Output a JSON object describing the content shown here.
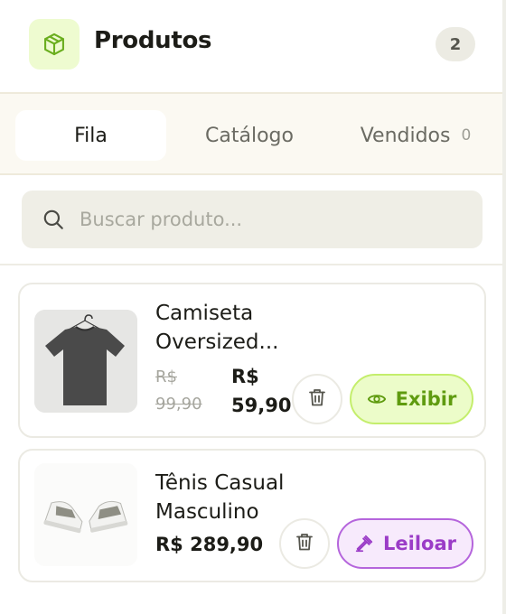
{
  "header": {
    "title": "Produtos",
    "count": "2",
    "icon": "package-icon",
    "accent": "#eefbd0"
  },
  "tabs": [
    {
      "label": "Fila",
      "active": true
    },
    {
      "label": "Catálogo",
      "active": false
    },
    {
      "label": "Vendidos",
      "count": "0",
      "active": false
    }
  ],
  "search": {
    "placeholder": "Buscar produto...",
    "value": ""
  },
  "products": [
    {
      "name": "Camiseta Oversized...",
      "old_price": "R$ 99,90",
      "price": "R$ 59,90",
      "action": "Exibir",
      "action_icon": "eye-icon",
      "action_color": "#5f9b0f"
    },
    {
      "name": "Tênis Casual Masculino",
      "price": "R$ 289,90",
      "action": "Leiloar",
      "action_icon": "gavel-icon",
      "action_color": "#9b3cc7"
    }
  ]
}
